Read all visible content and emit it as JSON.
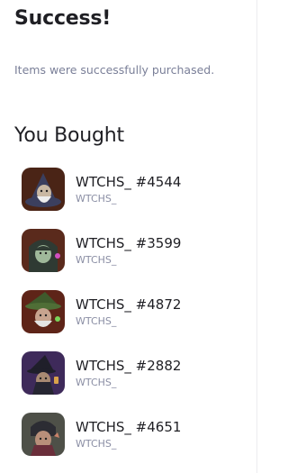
{
  "header": {
    "title": "Success!",
    "message": "Items were successfully purchased."
  },
  "section": {
    "heading": "You Bought"
  },
  "items": [
    {
      "name": "WTCHS_ #4544",
      "collection": "WTCHS_",
      "bg": "#4a2416"
    },
    {
      "name": "WTCHS_ #3599",
      "collection": "WTCHS_",
      "bg": "#5a2a1c"
    },
    {
      "name": "WTCHS_ #4872",
      "collection": "WTCHS_",
      "bg": "#5e2418"
    },
    {
      "name": "WTCHS_ #2882",
      "collection": "WTCHS_",
      "bg": "#3e2a5a"
    },
    {
      "name": "WTCHS_ #4651",
      "collection": "WTCHS_",
      "bg": "#4e5048"
    }
  ]
}
